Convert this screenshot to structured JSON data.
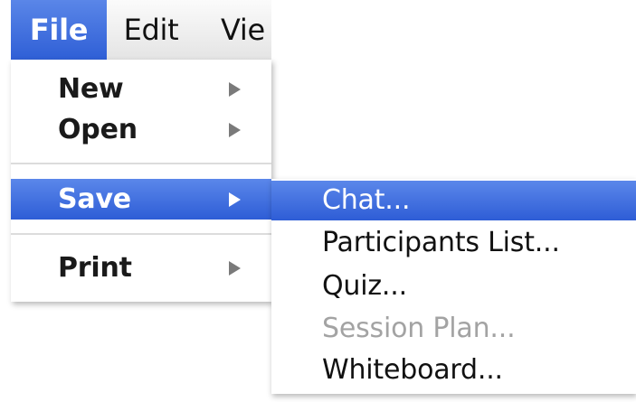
{
  "menubar": {
    "items": [
      {
        "label": "File",
        "state": "open"
      },
      {
        "label": "Edit"
      },
      {
        "label": "Vie"
      }
    ]
  },
  "file_menu": {
    "items": [
      {
        "label": "New",
        "has_submenu": true
      },
      {
        "label": "Open",
        "has_submenu": true
      },
      {
        "label": "Save",
        "has_submenu": true,
        "state": "highlighted"
      },
      {
        "label": "Print",
        "has_submenu": true
      }
    ]
  },
  "save_submenu": {
    "items": [
      {
        "label": "Chat...",
        "state": "highlighted"
      },
      {
        "label": "Participants List..."
      },
      {
        "label": "Quiz..."
      },
      {
        "label": "Session Plan...",
        "state": "disabled"
      },
      {
        "label": "Whiteboard..."
      }
    ]
  },
  "colors": {
    "highlight": "#2e5dd6",
    "disabled_text": "#a3a3a3",
    "arrow": "#7a7a7a"
  },
  "icons": {
    "submenu_arrow": "submenu-arrow-icon"
  }
}
